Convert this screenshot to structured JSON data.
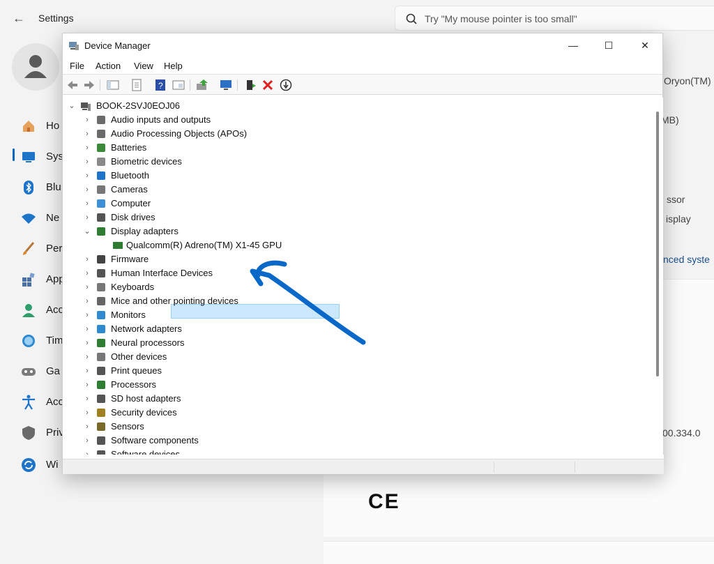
{
  "settings": {
    "title": "Settings",
    "search_placeholder": "Try \"My mouse pointer is too small\"",
    "nav_items": [
      {
        "label": "Ho",
        "icon": "home-icon"
      },
      {
        "label": "Sys",
        "icon": "system-icon"
      },
      {
        "label": "Blu",
        "icon": "bluetooth-icon"
      },
      {
        "label": "Ne",
        "icon": "network-icon"
      },
      {
        "label": "Per",
        "icon": "personalization-icon"
      },
      {
        "label": "App",
        "icon": "apps-icon"
      },
      {
        "label": "Acc",
        "icon": "accounts-icon"
      },
      {
        "label": "Tim",
        "icon": "time-language-icon"
      },
      {
        "label": "Ga",
        "icon": "gaming-icon"
      },
      {
        "label": "Acc",
        "icon": "accessibility-icon"
      },
      {
        "label": "Priv",
        "icon": "privacy-icon"
      },
      {
        "label": "Wi",
        "icon": "windows-update-icon"
      }
    ],
    "side_fragments": {
      "oryon": "Oryon(TM)",
      "mb": "MB)",
      "ssor": "ssor",
      "display": "isplay",
      "advanced": "nced syste",
      "version": "00.334.0"
    },
    "ce_mark": "CE"
  },
  "device_manager": {
    "title": "Device Manager",
    "menu": [
      "File",
      "Action",
      "View",
      "Help"
    ],
    "window_buttons": {
      "minimize": "—",
      "maximize": "☐",
      "close": "✕"
    },
    "root": "BOOK-2SVJ0EOJ06",
    "categories": [
      {
        "label": "Audio inputs and outputs",
        "icon": "speaker-icon"
      },
      {
        "label": "Audio Processing Objects (APOs)",
        "icon": "speaker-icon"
      },
      {
        "label": "Batteries",
        "icon": "battery-icon"
      },
      {
        "label": "Biometric devices",
        "icon": "fingerprint-icon"
      },
      {
        "label": "Bluetooth",
        "icon": "bluetooth-icon"
      },
      {
        "label": "Cameras",
        "icon": "camera-icon"
      },
      {
        "label": "Computer",
        "icon": "computer-icon"
      },
      {
        "label": "Disk drives",
        "icon": "disk-icon"
      },
      {
        "label": "Display adapters",
        "icon": "display-adapter-icon",
        "expanded": true
      },
      {
        "label": "Firmware",
        "icon": "firmware-icon"
      },
      {
        "label": "Human Interface Devices",
        "icon": "hid-icon"
      },
      {
        "label": "Keyboards",
        "icon": "keyboard-icon"
      },
      {
        "label": "Mice and other pointing devices",
        "icon": "mouse-icon"
      },
      {
        "label": "Monitors",
        "icon": "monitor-icon"
      },
      {
        "label": "Network adapters",
        "icon": "network-adapter-icon"
      },
      {
        "label": "Neural processors",
        "icon": "processor-icon"
      },
      {
        "label": "Other devices",
        "icon": "unknown-device-icon"
      },
      {
        "label": "Print queues",
        "icon": "printer-icon"
      },
      {
        "label": "Processors",
        "icon": "processor-icon"
      },
      {
        "label": "SD host adapters",
        "icon": "sd-card-icon"
      },
      {
        "label": "Security devices",
        "icon": "security-device-icon"
      },
      {
        "label": "Sensors",
        "icon": "sensor-icon"
      },
      {
        "label": "Software components",
        "icon": "software-component-icon"
      },
      {
        "label": "Software devices",
        "icon": "software-device-icon"
      }
    ],
    "display_adapter_child": "Qualcomm(R) Adreno(TM) X1-45 GPU",
    "colors": {
      "selection_bg": "#cce8ff",
      "selection_border": "#99d1ff",
      "annotation_arrow": "#0a68c9"
    }
  }
}
